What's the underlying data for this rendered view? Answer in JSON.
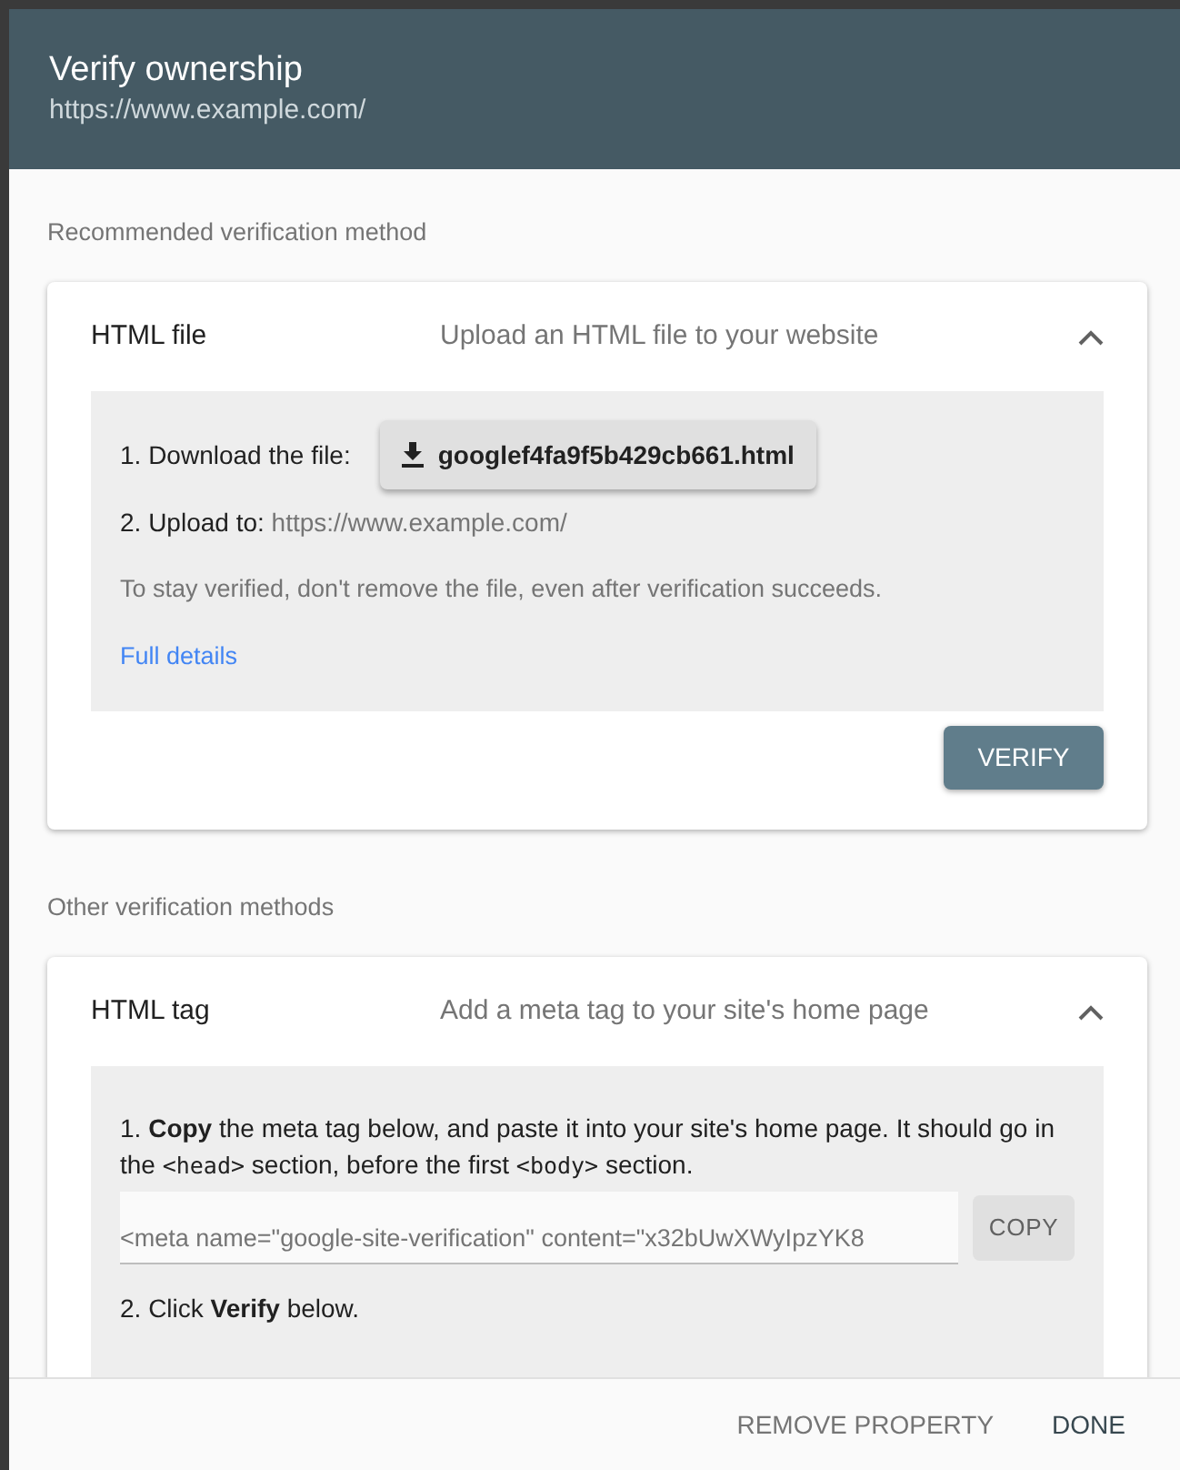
{
  "dialog": {
    "title": "Verify ownership",
    "subtitle": "https://www.example.com/"
  },
  "sections": [
    {
      "heading": "Recommended verification method",
      "method": {
        "name": "HTML file",
        "description": "Upload an HTML file to your website",
        "expanded": true,
        "kind": "file",
        "download_label": "1. Download the file:",
        "file_button": "googlef4fa9f5b429cb661.html",
        "upload_label": "2. Upload to:",
        "upload_url": "https://www.example.com/",
        "note": "To stay verified, don't remove the file, even after verification succeeds.",
        "link": "Full details",
        "action": "VERIFY"
      }
    },
    {
      "heading": "Other verification methods",
      "method": {
        "name": "HTML tag",
        "description": "Add a meta tag to your site's home page",
        "expanded": true,
        "kind": "tag",
        "instruction": [
          {
            "kind": "text",
            "text": "1. "
          },
          {
            "kind": "bold",
            "text": "Copy"
          },
          {
            "kind": "text",
            "text": " the meta tag below, and paste it into your site's home page. It should go in the "
          },
          {
            "kind": "code",
            "text": "<head>"
          },
          {
            "kind": "text",
            "text": " section, before the first "
          },
          {
            "kind": "code",
            "text": "<body>"
          },
          {
            "kind": "text",
            "text": " section."
          }
        ],
        "tag_value": "<meta name=\"google-site-verification\" content=\"x32bUwXWyIpzYK8",
        "copy_button": "COPY",
        "step2": "2. Click **Verify** below."
      }
    }
  ],
  "footer": {
    "buttons": [
      {
        "label": "REMOVE PROPERTY",
        "kind": "secondary"
      },
      {
        "label": "DONE",
        "kind": "primary"
      }
    ]
  }
}
